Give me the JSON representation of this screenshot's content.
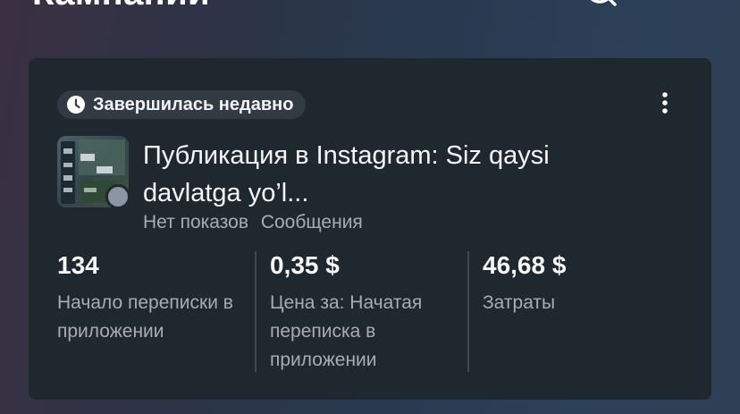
{
  "header": {
    "title": "Кампании",
    "search_icon": "search-icon",
    "grid_icon": "grid-icon"
  },
  "card": {
    "status": "Завершилась недавно",
    "status_icon": "clock-icon",
    "more_icon": "more-vertical-icon",
    "title": "Публикация в Instagram: Siz qaysi davlatga yo’l...",
    "delivery": "Нет показов",
    "objective": "Сообщения",
    "metrics": [
      {
        "value": "134",
        "label": "Начало переписки в приложении"
      },
      {
        "value": "0,35 $",
        "label": "Цена за: Начатая переписка в приложении"
      },
      {
        "value": "46,68 $",
        "label": "Затраты"
      }
    ]
  },
  "colors": {
    "card_bg": "#1f272f",
    "badge_bg": "#323a43",
    "text_primary": "#f5f7f9",
    "text_secondary": "#a6adb6",
    "status_dot": "#8b96a2"
  }
}
